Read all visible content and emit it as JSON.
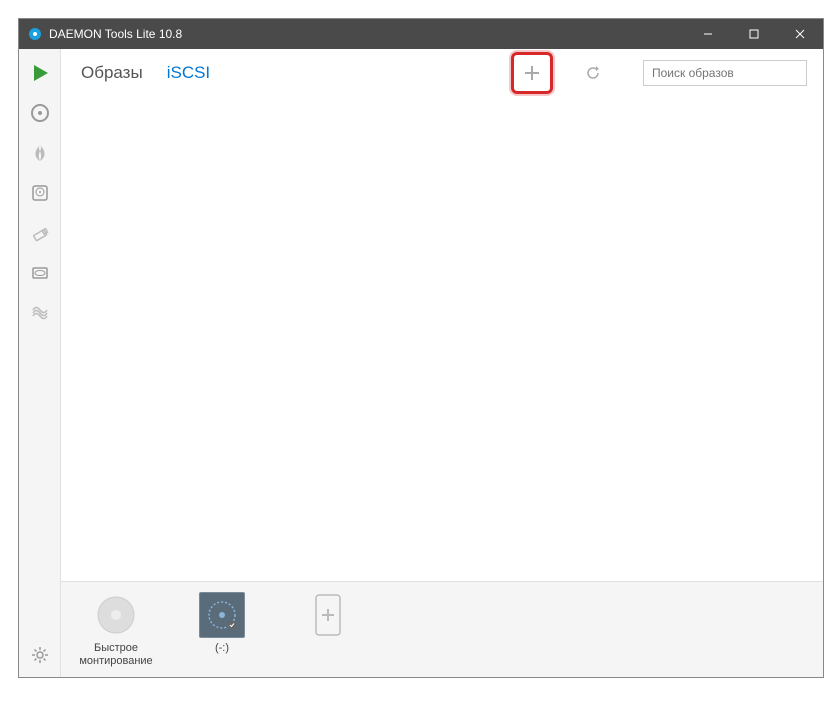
{
  "window": {
    "title": "DAEMON Tools Lite 10.8"
  },
  "tabs": {
    "images": "Образы",
    "iscsi": "iSCSI"
  },
  "search": {
    "placeholder": "Поиск образов"
  },
  "devices": {
    "quickmount": "Быстрое монтирование",
    "drive1": "(-:)"
  }
}
